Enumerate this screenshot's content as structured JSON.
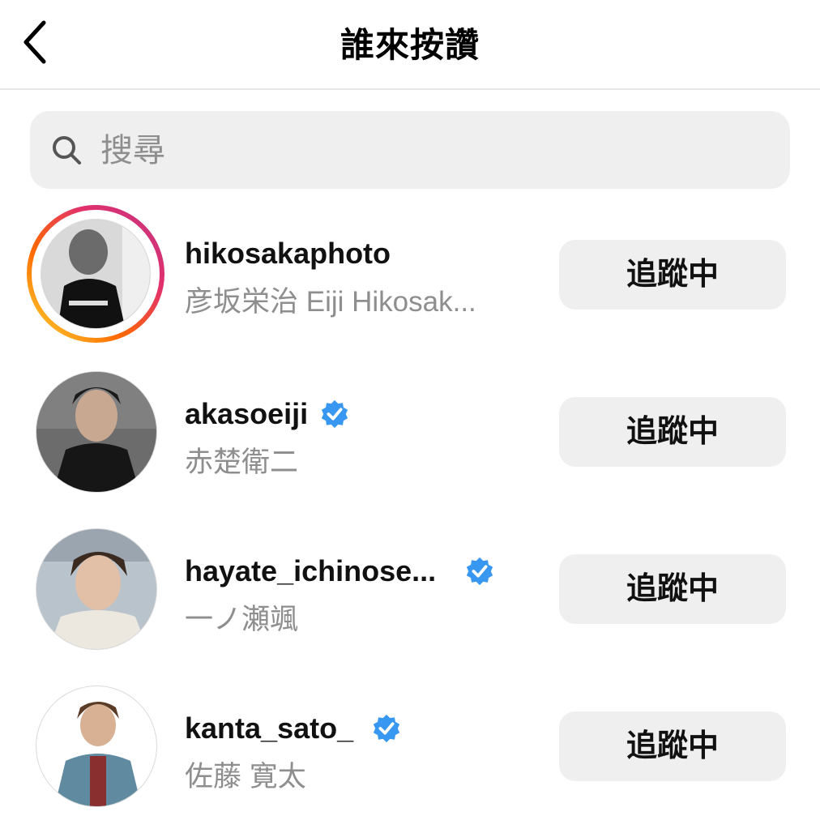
{
  "header": {
    "title": "誰來按讚",
    "back_icon": "chevron-left-icon"
  },
  "search": {
    "placeholder": "搜尋",
    "value": "",
    "icon": "search-icon"
  },
  "colors": {
    "verified": "#3897f0",
    "button_bg": "#efefef",
    "secondary_text": "#8e8e8e",
    "story_ring": [
      "#fdd835",
      "#ff6a00",
      "#e1306c",
      "#c13584"
    ]
  },
  "users": [
    {
      "username": "hikosakaphoto",
      "full_name": "彦坂栄治 Eiji Hikosak...",
      "verified": false,
      "has_story": true,
      "button": "追蹤中"
    },
    {
      "username": "akasoeiji",
      "full_name": "赤楚衛二",
      "verified": true,
      "has_story": false,
      "button": "追蹤中"
    },
    {
      "username": "hayate_ichinose...",
      "full_name": "一ノ瀬颯",
      "verified": true,
      "has_story": false,
      "button": "追蹤中"
    },
    {
      "username": "kanta_sato_",
      "full_name": "佐藤 寛太",
      "verified": true,
      "has_story": false,
      "button": "追蹤中"
    }
  ]
}
